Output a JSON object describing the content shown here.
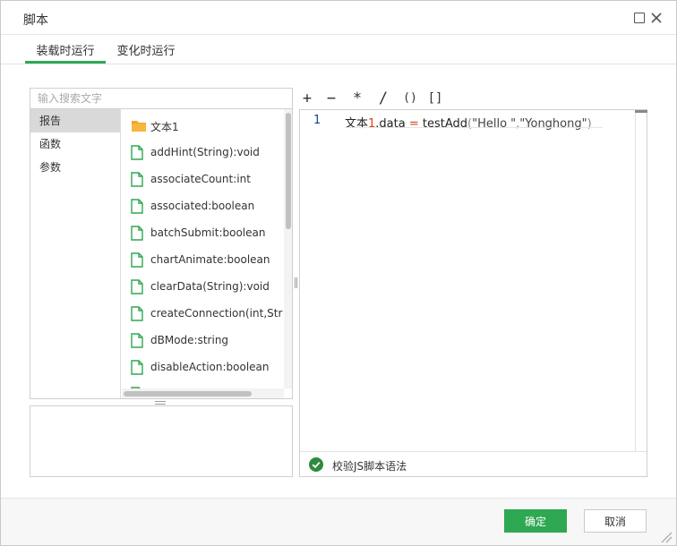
{
  "dialog": {
    "title": "脚本"
  },
  "tabs": [
    {
      "label": "装载时运行",
      "active": true
    },
    {
      "label": "变化时运行",
      "active": false
    }
  ],
  "search": {
    "placeholder": "输入搜索文字",
    "value": ""
  },
  "categories": [
    {
      "label": "报告",
      "active": true
    },
    {
      "label": "函数",
      "active": false
    },
    {
      "label": "参数",
      "active": false
    }
  ],
  "members": [
    {
      "label": "文本1",
      "icon": "folder-icon"
    },
    {
      "label": "addHint(String):void",
      "icon": "file-icon"
    },
    {
      "label": "associateCount:int",
      "icon": "file-icon"
    },
    {
      "label": "associated:boolean",
      "icon": "file-icon"
    },
    {
      "label": "batchSubmit:boolean",
      "icon": "file-icon"
    },
    {
      "label": "chartAnimate:boolean",
      "icon": "file-icon"
    },
    {
      "label": "clearData(String):void",
      "icon": "file-icon"
    },
    {
      "label": "createConnection(int,String):",
      "icon": "file-icon"
    },
    {
      "label": "dBMode:string",
      "icon": "file-icon"
    },
    {
      "label": "disableAction:boolean",
      "icon": "file-icon"
    }
  ],
  "toolbar": {
    "plus": "+",
    "minus": "−",
    "multiply": "*",
    "divide": "/",
    "parens": "()",
    "brackets": "[]"
  },
  "editor": {
    "line_number": "1",
    "code": {
      "object": "文本",
      "index": "1",
      "property": ".data ",
      "assign": "=",
      "func": " testAdd",
      "open": "(",
      "arg1": "\"Hello \"",
      "comma": ",",
      "arg2": "\"Yonghong\"",
      "close": ")"
    }
  },
  "status": {
    "label": "校验JS脚本语法"
  },
  "buttons": {
    "ok": "确定",
    "cancel": "取消"
  },
  "colors": {
    "accent": "#2fa852",
    "folder": "#f5a623",
    "file": "#2fa852"
  }
}
